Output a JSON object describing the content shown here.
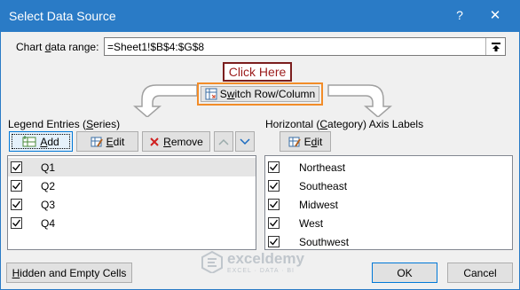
{
  "window": {
    "title": "Select Data Source",
    "help": "?",
    "close": "✕"
  },
  "range": {
    "label": "Chart data range:",
    "value": "=Sheet1!$B$4:$G$8"
  },
  "callout": "Click Here",
  "switch_button": "Switch Row/Column",
  "legend": {
    "title": "Legend Entries (Series)",
    "add": "Add",
    "edit": "Edit",
    "remove": "Remove",
    "items": [
      {
        "label": "Q1",
        "checked": true
      },
      {
        "label": "Q2",
        "checked": true
      },
      {
        "label": "Q3",
        "checked": true
      },
      {
        "label": "Q4",
        "checked": true
      }
    ]
  },
  "axis": {
    "title": "Horizontal (Category) Axis Labels",
    "edit": "Edit",
    "items": [
      {
        "label": "Northeast",
        "checked": true
      },
      {
        "label": "Southeast",
        "checked": true
      },
      {
        "label": "Midwest",
        "checked": true
      },
      {
        "label": "West",
        "checked": true
      },
      {
        "label": "Southwest",
        "checked": true
      }
    ]
  },
  "footer": {
    "hidden_cells": "Hidden and Empty Cells",
    "ok": "OK",
    "cancel": "Cancel"
  },
  "watermark": {
    "name": "exceldemy",
    "tagline": "EXCEL · DATA · BI"
  },
  "colors": {
    "titlebar": "#2a7bc6",
    "callout_border": "#7b1e1e",
    "switch_highlight": "#f28c28",
    "selection": "#e5e5e5"
  }
}
